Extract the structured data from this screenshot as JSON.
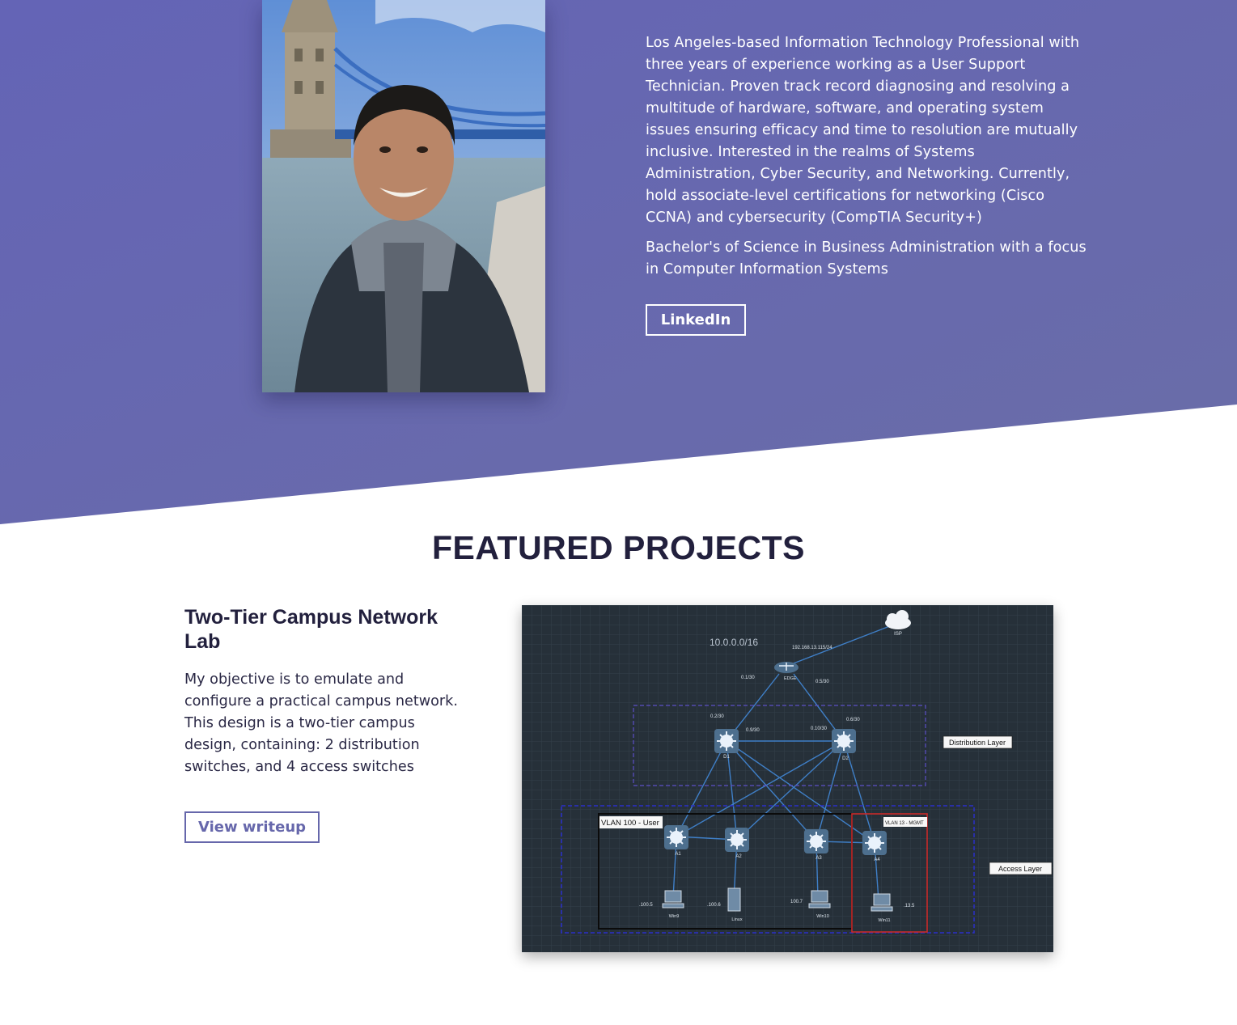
{
  "colors": {
    "hero": "#6667ab",
    "heading": "#22203d",
    "diagram_bg": "#263039"
  },
  "hero": {
    "bio_paragraph_1": "Los Angeles-based Information Technology Professional with three years of experience working as a User Support Technician. Proven track record diagnosing and resolving a multitude of hardware, software, and operating system issues ensuring efficacy and time to resolution are mutually inclusive. Interested in the realms of Systems Administration, Cyber Security, and Networking. Currently, hold associate-level certifications for networking (Cisco CCNA) and cybersecurity (CompTIA Security+)",
    "bio_paragraph_2": "Bachelor's of Science in Business Administration with a focus in Computer Information Systems",
    "linkedin_label": "LinkedIn"
  },
  "projects": {
    "section_title": "FEATURED PROJECTS",
    "items": [
      {
        "title": "Two-Tier Campus Network Lab",
        "description": "My objective is to emulate and configure a practical campus network. This design is a two-tier campus design, containing: 2 distribution switches, and 4 access switches",
        "button_label": "View writeup",
        "diagram": {
          "network_label": "10.0.0.0/16",
          "isp_label": "ISP",
          "isp_ip": "192.168.13.115/24",
          "edge_label": "EDGE",
          "distribution_layer_label": "Distribution Layer",
          "access_layer_label": "Access Layer",
          "vlan_users_label": "VLAN 100 - User",
          "vlan_mgmt_label": "VLAN 13 - MGMT",
          "d1_label": "D1",
          "d2_label": "D2",
          "a1_label": "A1",
          "a2_label": "A2",
          "a3_label": "A3",
          "a4_label": "A4",
          "host_win9": "Win9",
          "host_linux": "Linux",
          "host_win10": "Win10",
          "host_win11": "Win11",
          "ip_100_5": ".100.5",
          "ip_100_6": ".100.6",
          "ip_100_7": "100.7",
          "ip_13_5": ".13.5",
          "sub_0_1_30": "0.1/30",
          "sub_0_5_30": "0.5/30",
          "sub_0_2_30": "0.2/30",
          "sub_0_9_30": "0.9/30",
          "sub_0_10_30": "0.10/30",
          "sub_0_6_30": "0.6/30"
        }
      }
    ]
  }
}
